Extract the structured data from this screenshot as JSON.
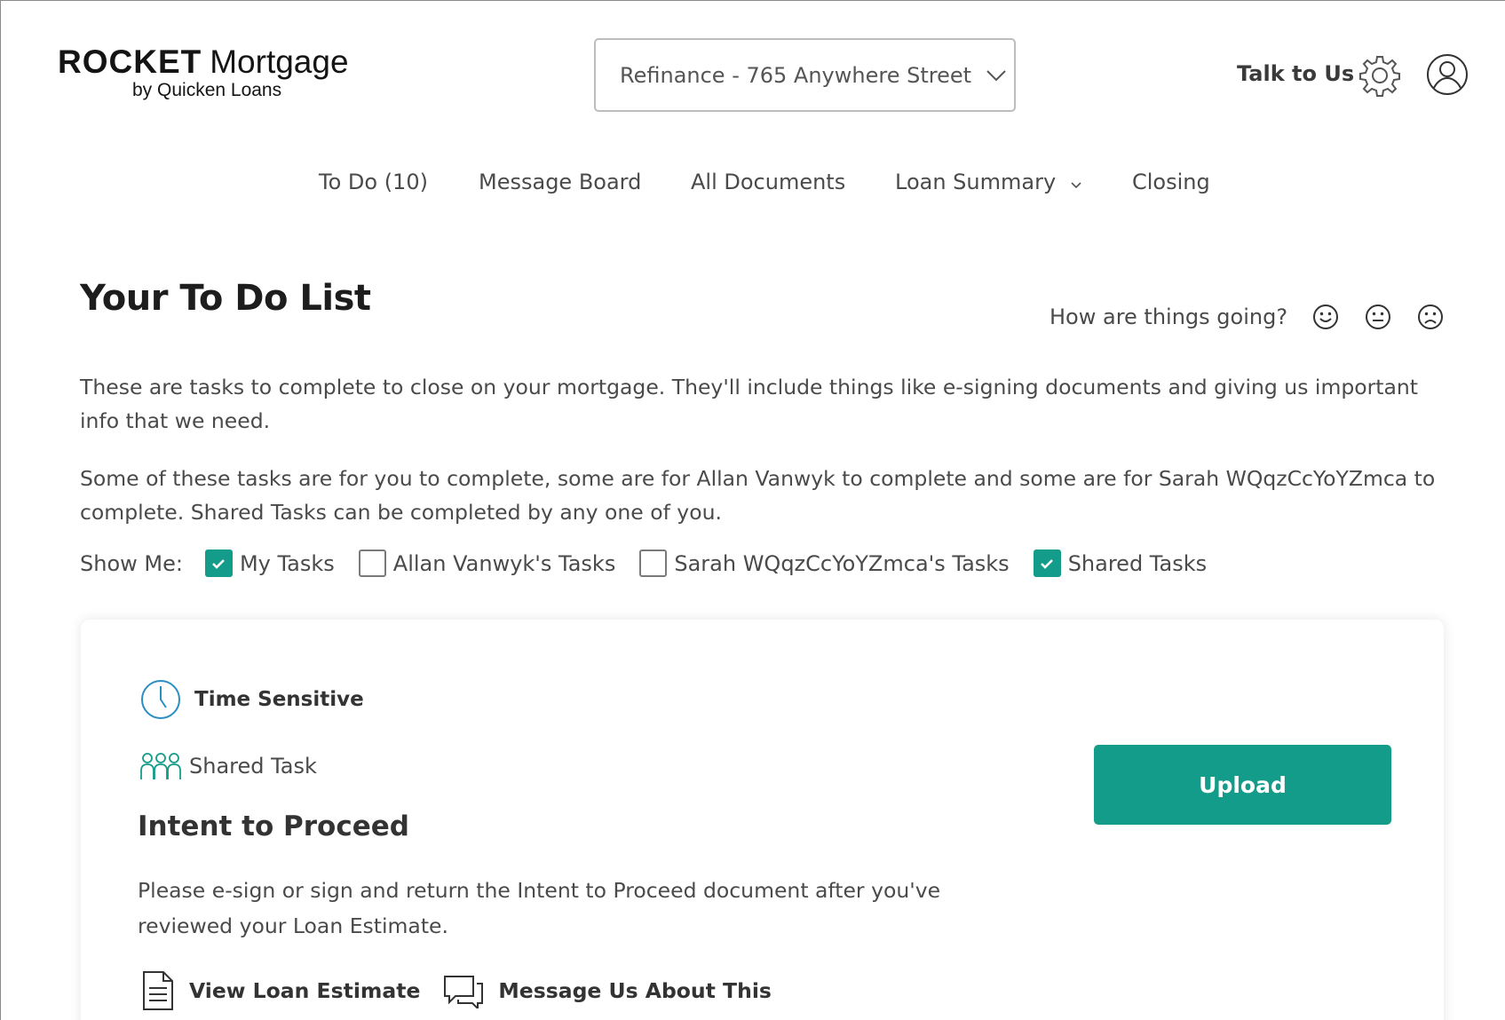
{
  "header": {
    "logo_rocket": "ROCKET",
    "logo_mortgage": "Mortgage",
    "logo_sub": "by Quicken Loans",
    "loan_selector": "Refinance - 765 Anywhere Street",
    "talk_label": "Talk to Us"
  },
  "nav": {
    "todo": "To Do (10)",
    "message_board": "Message Board",
    "all_documents": "All Documents",
    "loan_summary": "Loan Summary",
    "closing": "Closing"
  },
  "page": {
    "title": "Your To Do List",
    "feedback_prompt": "How are things going?",
    "para1": "These are tasks to complete to close on your mortgage. They'll include things like e-signing documents and giving us important info that we need.",
    "para2": "Some of these tasks are for you to complete, some are for Allan Vanwyk to complete and some are for Sarah WQqzCcYoYZmca to complete. Shared Tasks can be completed by any one of you."
  },
  "filters": {
    "label": "Show Me:",
    "options": [
      {
        "label": "My Tasks",
        "checked": true
      },
      {
        "label": "Allan Vanwyk's Tasks",
        "checked": false
      },
      {
        "label": "Sarah WQqzCcYoYZmca's Tasks",
        "checked": false
      },
      {
        "label": "Shared Tasks",
        "checked": true
      }
    ]
  },
  "task": {
    "priority": "Time Sensitive",
    "type": "Shared Task",
    "title": "Intent to Proceed",
    "description": "Please e-sign or sign and return the Intent to Proceed document after you've reviewed your Loan Estimate.",
    "link_view": "View Loan Estimate",
    "link_message": "Message Us About This",
    "action": "Upload"
  },
  "colors": {
    "accent": "#129c89",
    "clock_icon": "#2a8fc0",
    "people_icon": "#129c89"
  },
  "icons": [
    "clock-icon",
    "people-icon",
    "document-icon",
    "chat-icon",
    "gear-icon",
    "user-icon",
    "smile-icon",
    "neutral-face-icon",
    "sad-face-icon",
    "chevron-down-icon",
    "check-icon"
  ]
}
